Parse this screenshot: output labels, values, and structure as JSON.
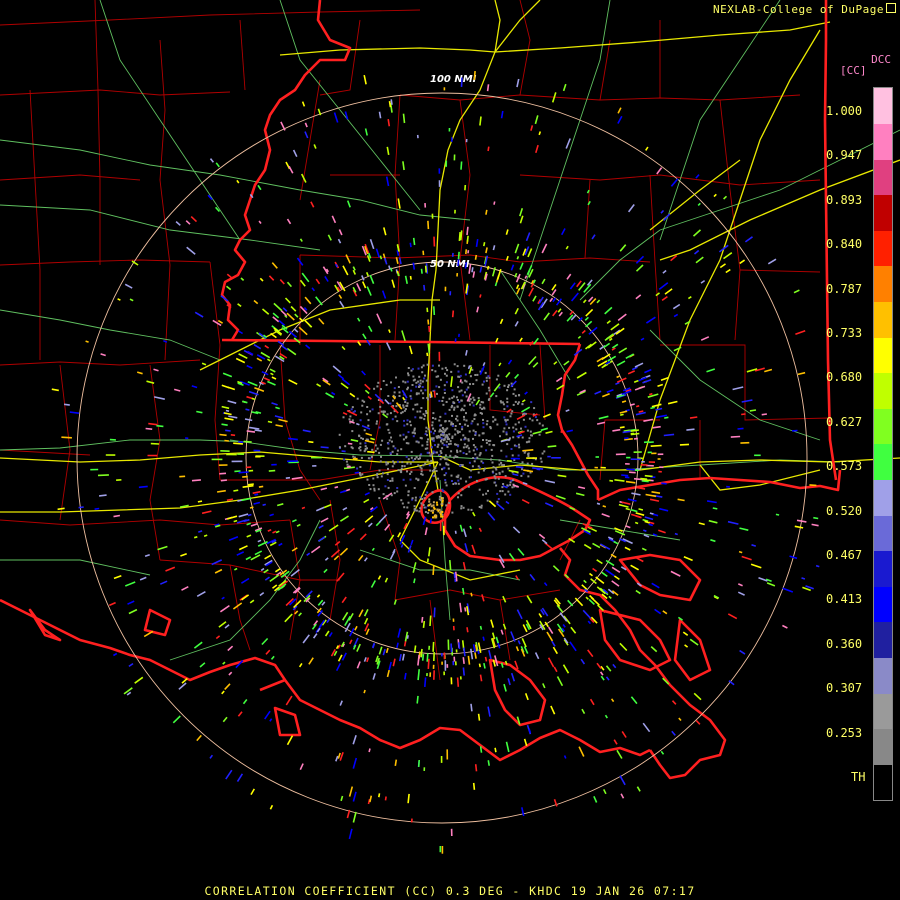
{
  "header": {
    "credit": "NEXLAB-College of DuPage"
  },
  "legend": {
    "product_code": "DCC",
    "unit": "[CC]",
    "ticks": [
      "1.000",
      "0.947",
      "0.893",
      "0.840",
      "0.787",
      "0.733",
      "0.680",
      "0.627",
      "0.573",
      "0.520",
      "0.467",
      "0.413",
      "0.360",
      "0.307",
      "0.253",
      "TH"
    ],
    "colors": [
      "#000000",
      "#888888",
      "#9a9a9a",
      "#8a8ac8",
      "#2020a0",
      "#0000ff",
      "#1a1ad0",
      "#6a6ad8",
      "#a0a0e8",
      "#40ff40",
      "#80ff20",
      "#c0ff00",
      "#ffff00",
      "#ffc000",
      "#ff8000",
      "#ff2000",
      "#c00000",
      "#e04080",
      "#ff80c0",
      "#ffc0e0"
    ]
  },
  "rings": {
    "inner_label": "50 NMI",
    "outer_label": "100 NMI"
  },
  "footer": {
    "title": "CORRELATION COEFFICIENT (CC) 0.3 DEG - KHDC 19 JAN 26 07:17"
  },
  "map_colors": {
    "state_border": "#ff2020",
    "county": "#b00000",
    "highway": "#e8e800",
    "road": "#60c060",
    "range_ring": "#f0c0a0"
  }
}
